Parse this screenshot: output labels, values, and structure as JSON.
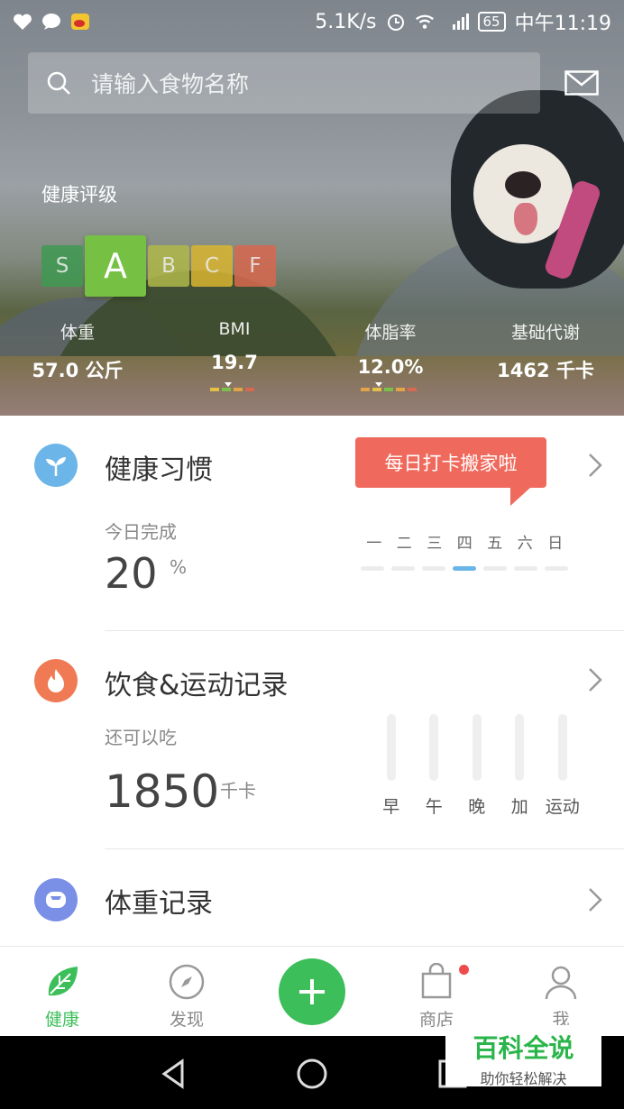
{
  "status_bar": {
    "speed": "5.1K/s",
    "network": "4G",
    "battery": "65",
    "time": "中午11:19",
    "left_icons": [
      "health-heart-icon",
      "chat-bubble-icon",
      "weibo-icon"
    ]
  },
  "search": {
    "placeholder": "请输入食物名称"
  },
  "health_rating": {
    "title": "健康评级",
    "grades": [
      {
        "label": "S",
        "color": "#3f9a52"
      },
      {
        "label": "A",
        "color": "#76c043"
      },
      {
        "label": "B",
        "color": "#b0b84a"
      },
      {
        "label": "C",
        "color": "#d9b531"
      },
      {
        "label": "F",
        "color": "#d8684f"
      }
    ],
    "selected": "A"
  },
  "stats": [
    {
      "label": "体重",
      "value": "57.0 公斤"
    },
    {
      "label": "BMI",
      "value": "19.7"
    },
    {
      "label": "体脂率",
      "value": "12.0%"
    },
    {
      "label": "基础代谢",
      "value": "1462 千卡"
    }
  ],
  "habits": {
    "title": "健康习惯",
    "tooltip": "每日打卡搬家啦",
    "today_label": "今日完成",
    "percent": "20",
    "percent_unit": "%",
    "days": [
      "一",
      "二",
      "三",
      "四",
      "五",
      "六",
      "日"
    ],
    "current_day": "四"
  },
  "diet": {
    "title": "饮食&运动记录",
    "remaining_label": "还可以吃",
    "calories": "1850",
    "calories_unit": "千卡",
    "meals": [
      "早",
      "午",
      "晚",
      "加",
      "运动"
    ]
  },
  "weight": {
    "title": "体重记录"
  },
  "bottom_nav": {
    "items": [
      {
        "label": "健康",
        "icon": "leaf-icon",
        "active": true
      },
      {
        "label": "发现",
        "icon": "compass-icon",
        "active": false
      },
      {
        "label": "商店",
        "icon": "shopping-bag-icon",
        "active": false
      },
      {
        "label": "我",
        "icon": "user-icon",
        "active": false
      }
    ],
    "accent": "#3cbf5a"
  },
  "watermark": {
    "title": "百科全说",
    "subtitle": "助你轻松解决"
  }
}
